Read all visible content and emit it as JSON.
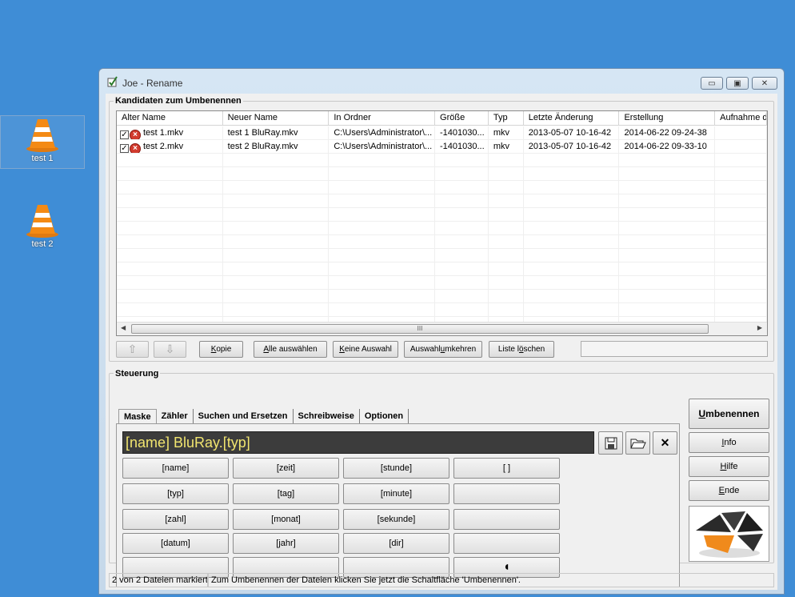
{
  "desktop": {
    "icons": [
      {
        "label": "test 1",
        "icon": "vlc-cone-icon"
      },
      {
        "label": "test 2",
        "icon": "vlc-cone-icon"
      }
    ]
  },
  "window": {
    "title": "Joe - Rename",
    "controls": {
      "minimize": "▭",
      "maximize": "▣",
      "close": "✕"
    }
  },
  "candidates": {
    "group_title": "Kandidaten zum Umbenennen",
    "columns": [
      "Alter Name",
      "Neuer Name",
      "In Ordner",
      "Größe",
      "Typ",
      "Letzte Änderung",
      "Erstellung",
      "Aufnahme d"
    ],
    "rows": [
      {
        "old_name": "test 1.mkv",
        "new_name": "test 1 BluRay.mkv",
        "folder": "C:\\Users\\Administrator\\...",
        "size": "-1401030...",
        "type": "mkv",
        "modified": "2013-05-07 10-16-42",
        "created": "2014-06-22 09-24-38",
        "recorded": ""
      },
      {
        "old_name": "test 2.mkv",
        "new_name": "test 2 BluRay.mkv",
        "folder": "C:\\Users\\Administrator\\...",
        "size": "-1401030...",
        "type": "mkv",
        "modified": "2013-05-07 10-16-42",
        "created": "2014-06-22 09-33-10",
        "recorded": ""
      }
    ],
    "scroll_grip": "III"
  },
  "list_buttons": {
    "up": "⇧",
    "down": "⇩",
    "copy_u": "K",
    "copy_rest": "opie",
    "select_all_u": "A",
    "select_all_rest": "lle auswählen",
    "none_u": "K",
    "none_rest": "eine Auswahl",
    "invert_pre": "Auswahl ",
    "invert_u": "u",
    "invert_rest": "mkehren",
    "clear_pre": "Liste l",
    "clear_u": "ö",
    "clear_rest": "schen"
  },
  "control": {
    "group_title": "Steuerung",
    "tabs": [
      "Maske",
      "Zähler",
      "Suchen und Ersetzen",
      "Schreibweise",
      "Optionen"
    ],
    "mask_value": "[name] BluRay.[typ]",
    "tokens": [
      [
        "[name]",
        "[zeit]",
        "[stunde]",
        "[ ]"
      ],
      [
        "[typ]",
        "[tag]",
        "[minute]",
        ""
      ],
      [
        "[zahl]",
        "[monat]",
        "[sekunde]",
        ""
      ],
      [
        "[datum]",
        "[jahr]",
        "[dir]",
        ""
      ],
      [
        "",
        "",
        "",
        "◖"
      ]
    ]
  },
  "actions": {
    "rename_u": "U",
    "rename_rest": "mbenennen",
    "info_u": "I",
    "info_rest": "nfo",
    "help_u": "H",
    "help_rest": "ilfe",
    "end_u": "E",
    "end_rest": "nde"
  },
  "status": {
    "marked": "2 von 2 Dateien markiert",
    "hint": "Zum Umbenennen der Dateien klicken Sie jetzt die Schaltfläche 'Umbenennen'."
  }
}
